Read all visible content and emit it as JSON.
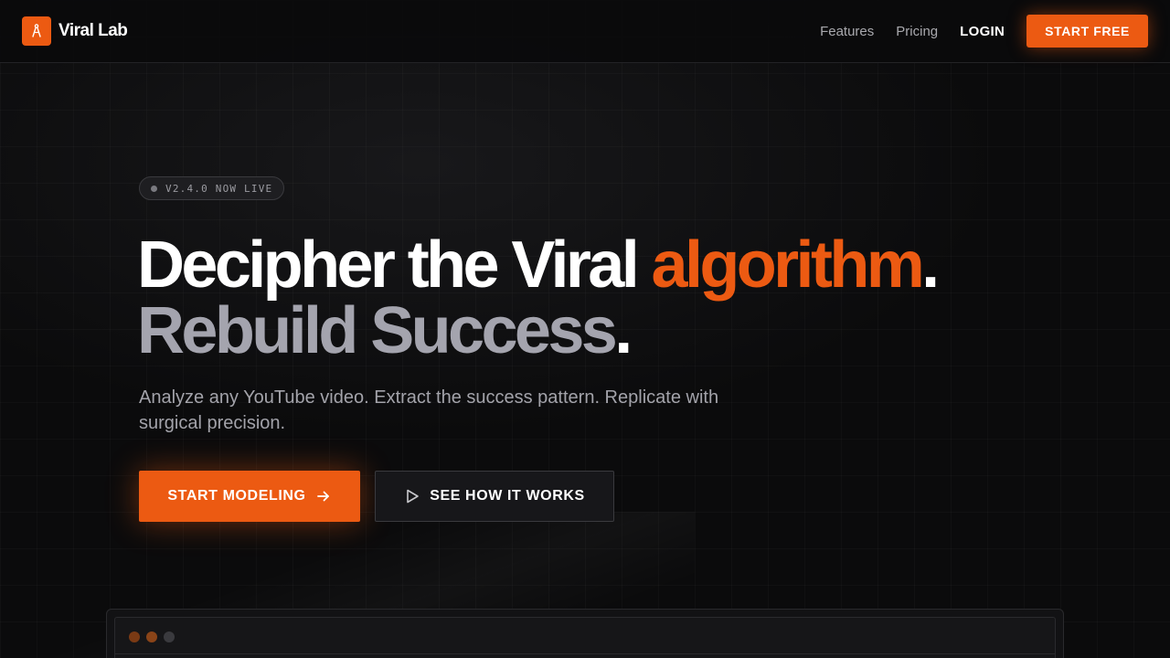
{
  "nav": {
    "brand_name": "Viral Lab",
    "links": [
      "Features",
      "Pricing"
    ],
    "login": "LOGIN",
    "cta": "START FREE"
  },
  "hero": {
    "badge": "V2.4.0 NOW LIVE",
    "headline_line1_main": "Decipher the Viral",
    "headline_line1_accent": "algorithm",
    "headline_line1_end": ".",
    "headline_line2_main": "Rebuild Success",
    "headline_line2_end": ".",
    "subtitle": "Analyze any YouTube video. Extract the success pattern. Replicate with surgical precision.",
    "primary_cta": "START MODELING",
    "secondary_cta": "SEE HOW IT WORKS"
  },
  "colors": {
    "accent": "#ec5a12",
    "background": "#0b0b0c",
    "muted_text": "#a3a3aa"
  },
  "icons": {
    "brand": "compass-icon",
    "primary_cta": "arrow-right-icon",
    "secondary_cta": "play-icon"
  }
}
